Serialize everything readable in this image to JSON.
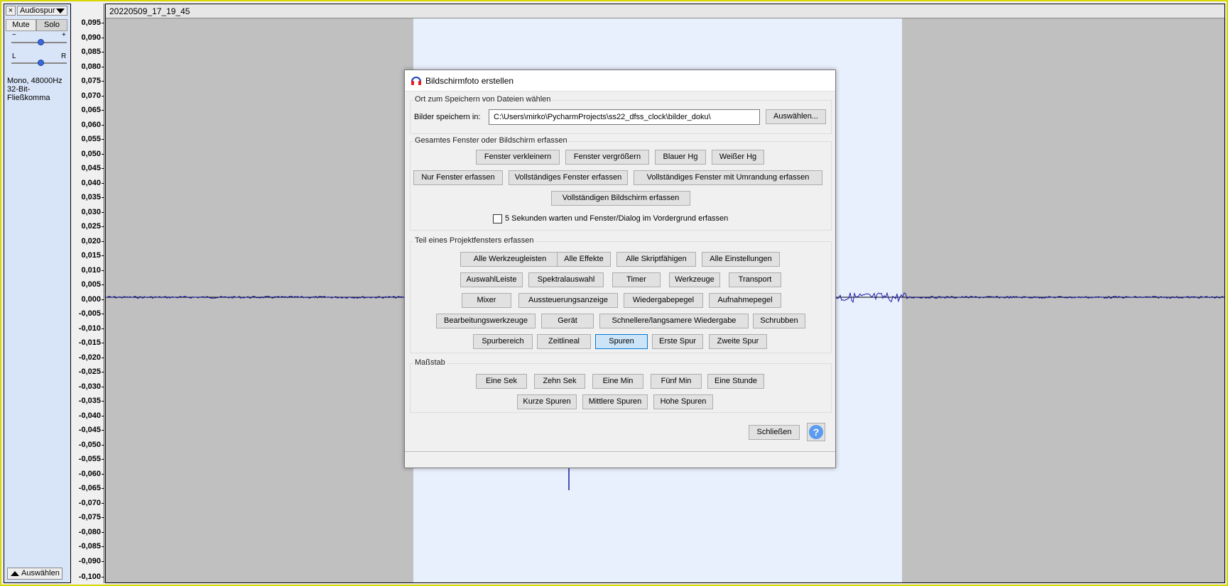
{
  "track": {
    "close_label": "×",
    "name": "Audiospur",
    "mute_label": "Mute",
    "solo_label": "Solo",
    "gain_minus": "−",
    "gain_plus": "+",
    "pan_left": "L",
    "pan_right": "R",
    "info_line1": "Mono, 48000Hz",
    "info_line2": "32-Bit-Fließkomma",
    "select_label": "Auswählen"
  },
  "ruler": {
    "ticks": [
      "0,095",
      "0,090",
      "0,085",
      "0,080",
      "0,075",
      "0,070",
      "0,065",
      "0,060",
      "0,055",
      "0,050",
      "0,045",
      "0,040",
      "0,035",
      "0,030",
      "0,025",
      "0,020",
      "0,015",
      "0,010",
      "0,005",
      "0,000",
      "-0,005",
      "-0,010",
      "-0,015",
      "-0,020",
      "-0,025",
      "-0,030",
      "-0,035",
      "-0,040",
      "-0,045",
      "-0,050",
      "-0,055",
      "-0,060",
      "-0,065",
      "-0,070",
      "-0,075",
      "-0,080",
      "-0,085",
      "-0,090",
      "-0,100"
    ]
  },
  "clip": {
    "title": "20220509_17_19_45"
  },
  "dialog": {
    "title": "Bildschirmfoto erstellen",
    "save_group": {
      "label": "Ort zum Speichern von Dateien wählen",
      "path_label": "Bilder speichern in:",
      "path_value": "C:\\Users\\mirko\\PycharmProjects\\ss22_dfss_clock\\bilder_doku\\",
      "browse": "Auswählen..."
    },
    "window_group": {
      "label": "Gesamtes Fenster oder Bildschirm erfassen",
      "row1": [
        "Fenster verkleinern",
        "Fenster vergrößern",
        "Blauer Hg",
        "Weißer Hg"
      ],
      "row2": [
        "Nur Fenster erfassen",
        "Vollständiges Fenster erfassen",
        "Vollständiges Fenster mit Umrandung erfassen"
      ],
      "row3": [
        "Vollständigen Bildschirm erfassen"
      ],
      "delay_label": "5 Sekunden warten und Fenster/Dialog im Vordergrund erfassen"
    },
    "project_group": {
      "label": "Teil eines Projektfensters erfassen",
      "row1": [
        "Alle Werkzeugleisten",
        "Alle Effekte",
        "Alle Skriptfähigen",
        "Alle Einstellungen"
      ],
      "row2": [
        "AuswahlLeiste",
        "Spektralauswahl",
        "Timer",
        "Werkzeuge",
        "Transport"
      ],
      "row3": [
        "Mixer",
        "Aussteuerungsanzeige",
        "Wiedergabepegel",
        "Aufnahmepegel"
      ],
      "row4": [
        "Bearbeitungswerkzeuge",
        "Gerät",
        "Schnellere/langsamere Wiedergabe",
        "Schrubben"
      ],
      "row5": [
        "Spurbereich",
        "Zeitlineal",
        "Spuren",
        "Erste Spur",
        "Zweite Spur"
      ]
    },
    "scale_group": {
      "label": "Maßstab",
      "row1": [
        "Eine Sek",
        "Zehn Sek",
        "Eine Min",
        "Fünf Min",
        "Eine Stunde"
      ],
      "row2": [
        "Kurze Spuren",
        "Mittlere Spuren",
        "Hohe Spuren"
      ]
    },
    "close_label": "Schließen",
    "help_label": "?"
  },
  "colors": {
    "waveform": "#1a1aa8",
    "selection": "#e9f0fd",
    "track_panel": "#d8e4f8",
    "frame": "#d8d800"
  }
}
